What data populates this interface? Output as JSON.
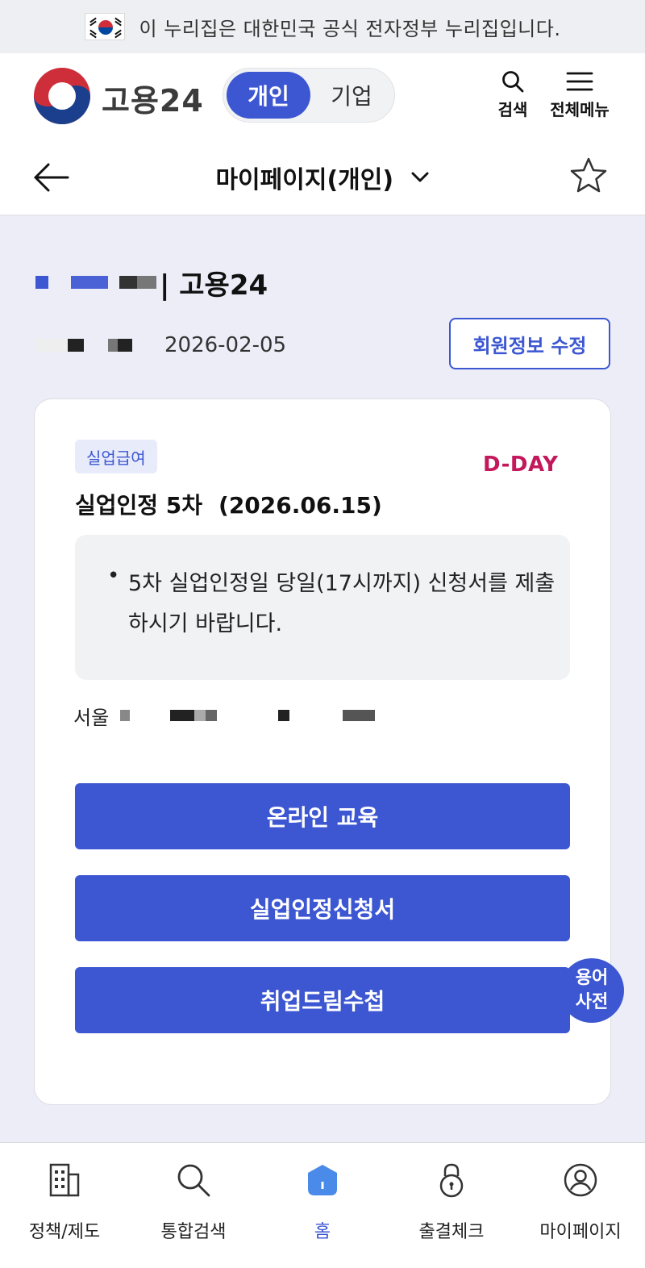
{
  "gov_banner": {
    "text": "이 누리집은 대한민국 공식 전자정부 누리집입니다."
  },
  "header": {
    "logo_text": "고용24",
    "toggle": {
      "personal": "개인",
      "business": "기업"
    },
    "search_label": "검색",
    "menu_label": "전체메뉴"
  },
  "titlebar": {
    "title": "마이페이지(개인)"
  },
  "profile": {
    "name_suffix": "| 고용24",
    "join_date": "2026-02-05",
    "edit_button": "회원정보 수정"
  },
  "card": {
    "badge": "실업급여",
    "dday": "D-DAY",
    "title": "실업인정 5차",
    "title_date": "(2026.06.15)",
    "notice_bullet": "•",
    "notice": "5차 실업인정일 당일(17시까지) 신청서를 제출하시기 바랍니다.",
    "office_prefix": "서울",
    "buttons": {
      "online_edu": "온라인 교육",
      "cert_form": "실업인정신청서",
      "dream_book": "취업드림수첩"
    }
  },
  "glossary_fab": {
    "line1": "용어",
    "line2": "사전"
  },
  "bottom_nav": {
    "policy": "정책/제도",
    "search": "통합검색",
    "home": "홈",
    "attendance": "출결체크",
    "mypage": "마이페이지"
  },
  "colors": {
    "primary": "#3c57d1",
    "dday": "#c3185b",
    "background": "#ecedf7"
  }
}
